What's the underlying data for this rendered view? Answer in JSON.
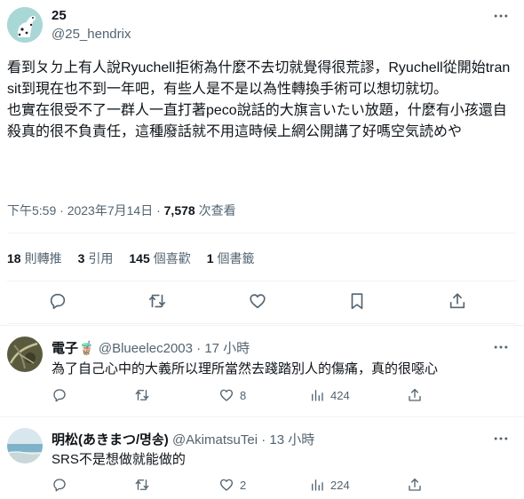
{
  "tweet": {
    "author_name": "25",
    "author_handle": "@25_hendrix",
    "text": "看到ㄆㄉ上有人說Ryuchell拒術為什麼不去切就覺得很荒謬，Ryuchell從開始transit到現在也不到一年吧，有些人是不是以為性轉換手術可以想切就切。\n也實在很受不了一群人一直打著peco說話的大旗言いたい放題，什麼有小孩還自殺真的很不負責任，這種廢話就不用這時候上網公開講了好嗎空気読めや",
    "time": "下午5:59 · 2023年7月14日 · ",
    "views_count": "7,578",
    "views_label": " 次查看",
    "stats": {
      "retweets_count": "18",
      "retweets_label": "則轉推",
      "quotes_count": "3",
      "quotes_label": "引用",
      "likes_count": "145",
      "likes_label": "個喜歡",
      "bookmarks_count": "1",
      "bookmarks_label": "個書籤"
    },
    "colors": {
      "text": "#0f1419",
      "secondary": "#536471",
      "divider": "#eff3f4"
    }
  },
  "replies": [
    {
      "name": "電子🧋",
      "handle": "@Blueelec2003",
      "time": "· 17 小時",
      "text": "為了自己心中的大義所以理所當然去踐踏別人的傷痛，真的很噁心",
      "likes": "8",
      "views": "424"
    },
    {
      "name": "明松(あきまつ/명송)",
      "handle": "@AkimatsuTei",
      "time": "· 13 小時",
      "text": "SRS不是想做就能做的",
      "likes": "2",
      "views": "224"
    }
  ]
}
